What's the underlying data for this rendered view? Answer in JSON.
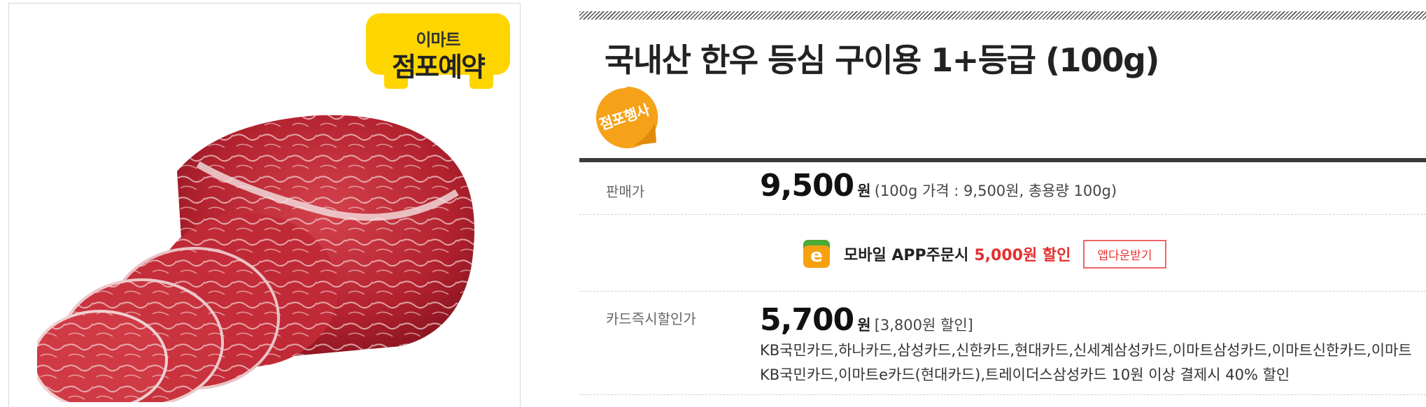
{
  "badge": {
    "line1": "이마트",
    "line2": "점포예약"
  },
  "product": {
    "title": "국내산 한우 등심 구이용 1+등급 (100g)",
    "store_badge": "점포행사"
  },
  "price": {
    "label": "판매가",
    "amount": "9,500",
    "unit": "원",
    "detail": "(100g 가격 : 9,500원, 총용량 100g)"
  },
  "app": {
    "icon_letter": "e",
    "text": "모바일 APP주문시",
    "discount": "5,000원 할인",
    "button": "앱다운받기"
  },
  "card": {
    "label": "카드즉시할인가",
    "amount": "5,700",
    "unit": "원",
    "discount": "[3,800원 할인]",
    "note": "KB국민카드,하나카드,삼성카드,신한카드,현대카드,신세계삼성카드,이마트삼성카드,이마트신한카드,이마트KB국민카드,이마트e카드(현대카드),트레이더스삼성카드 10원 이상 결제시 40% 할인"
  },
  "colors": {
    "badge_yellow": "#ffd500",
    "store_orange": "#f5a218",
    "discount_red": "#e32f2f",
    "app_icon": "#f6a10f"
  }
}
